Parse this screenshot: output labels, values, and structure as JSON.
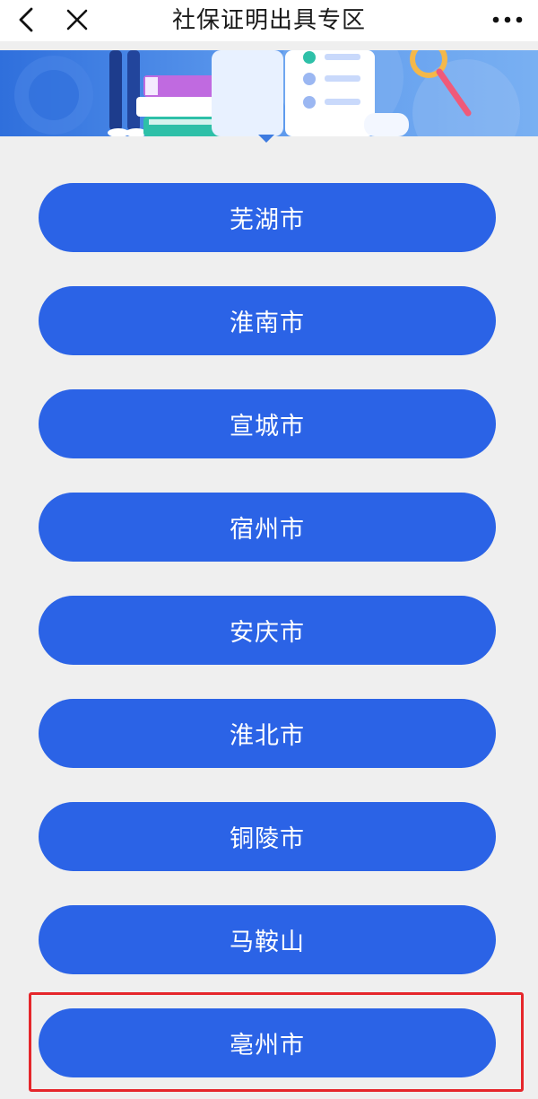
{
  "header": {
    "title": "社保证明出具专区"
  },
  "cities": [
    {
      "label": "芜湖市"
    },
    {
      "label": "淮南市"
    },
    {
      "label": "宣城市"
    },
    {
      "label": "宿州市"
    },
    {
      "label": "安庆市"
    },
    {
      "label": "淮北市"
    },
    {
      "label": "铜陵市"
    },
    {
      "label": "马鞍山"
    },
    {
      "label": "亳州市"
    }
  ],
  "highlighted_city": "亳州市",
  "colors": {
    "button_bg": "#2b63e6",
    "highlight_border": "#e5262b",
    "page_bg": "#efefef"
  }
}
